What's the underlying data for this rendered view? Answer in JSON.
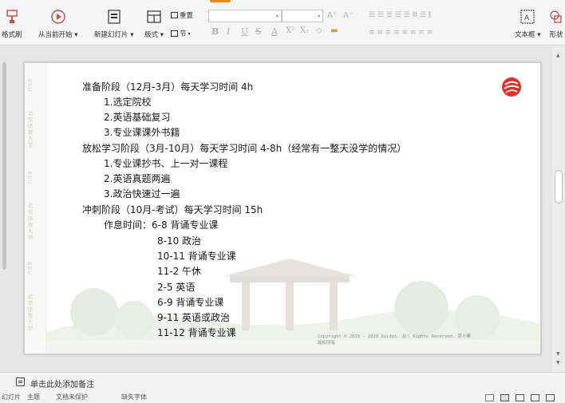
{
  "ribbon": {
    "format_painter": "格式刷",
    "play_from_current": "从当前开始",
    "new_slide": "新建幻灯片",
    "layout": "版式",
    "section": "节",
    "reset": "重置",
    "font_name": "",
    "font_size": "",
    "text_box": "文本框",
    "shape": "形状"
  },
  "slide": {
    "lines": [
      "准备阶段（12月-3月）每天学习时间 4h",
      "1.选定院校",
      "2.英语基础复习",
      "3.专业课课外书籍",
      "放松学习阶段（3月-10月）每天学习时间 4-8h（经常有一整天没学的情况）",
      "1.专业课抄书、上一对一课程",
      "2.英语真题两遍",
      "3.政治快速过一遍",
      "冲刺阶段（10月-考试）每天学习时间 15h",
      "作息时间：6-8    背诵专业课",
      "8-10  政治",
      "10-11 背诵专业课",
      "11-2   午休",
      "2-5    英语",
      "6-9    背诵专业课",
      "9-11   英语或政治",
      "11-12 背诵专业课"
    ],
    "copyright_line1": "Copyright © 2019 - 2020 Daidai. All Rights Reserved. 吴小寨",
    "copyright_line2": "版权所有",
    "watermark_bsu": "BSU",
    "watermark_school": "北京体育大学"
  },
  "notes": {
    "placeholder": "单击此处添加备注"
  },
  "status": {
    "slide_info": "幻灯片",
    "theme": "主题",
    "doc_check": "文档未保护",
    "missing_font": "缺失字体"
  },
  "colors": {
    "accent_orange": "#f08a24",
    "logo_red": "#e0312f"
  }
}
